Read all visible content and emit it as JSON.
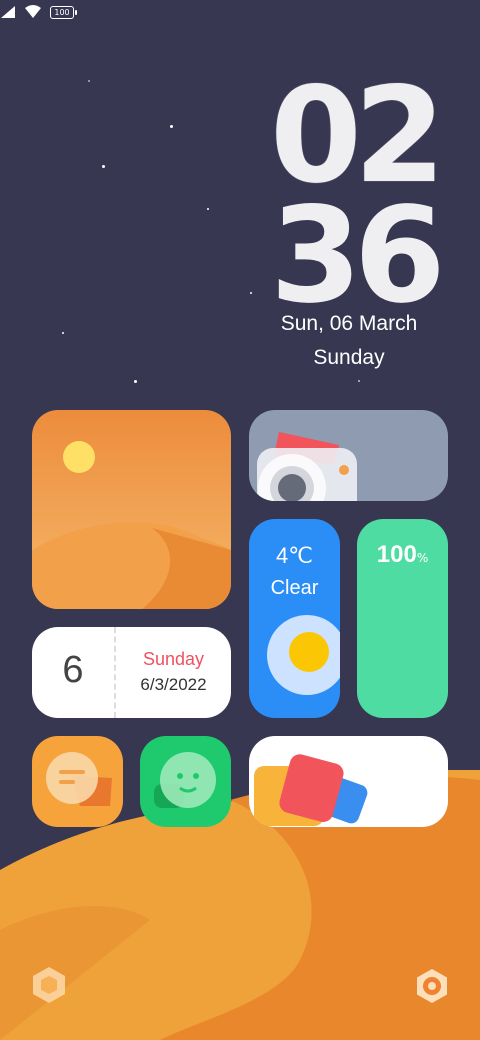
{
  "status_bar": {
    "battery": "100"
  },
  "clock": {
    "hour": "02",
    "minute": "36"
  },
  "lockscreen_date": {
    "date": "Sun, 06 March",
    "weekday": "Sunday"
  },
  "calendar_widget": {
    "day": "6",
    "weekday": "Sunday",
    "date": "6/3/2022"
  },
  "weather_widget": {
    "temperature": "4℃",
    "condition": "Clear"
  },
  "battery_widget": {
    "value": "100",
    "unit": "%"
  },
  "colors": {
    "background": "#373752",
    "weather": "#2b8ef7",
    "battery": "#4fdca2",
    "accent": "#f5a33a"
  }
}
